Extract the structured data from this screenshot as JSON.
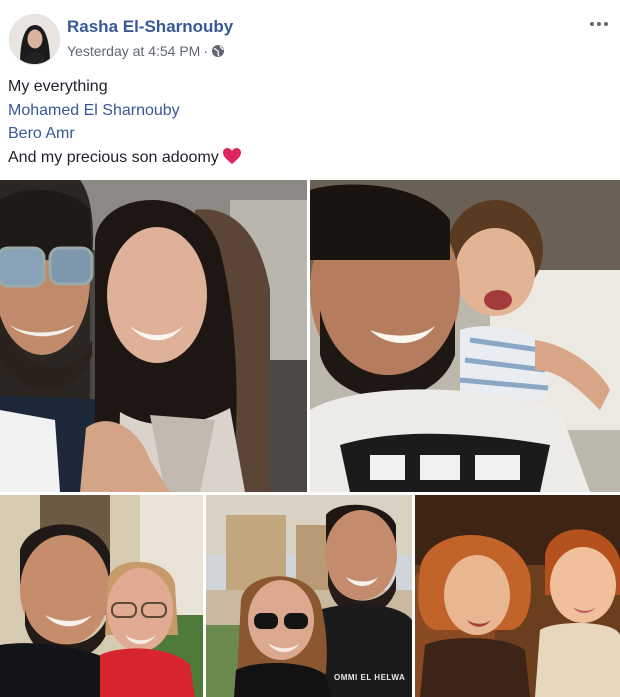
{
  "post": {
    "author_name": "Rasha El-Sharnouby",
    "timestamp": "Yesterday at 4:54 PM",
    "separator": "·",
    "privacy_icon": "globe-icon",
    "more_icon": "more-options-icon",
    "lines": {
      "line1": "My everything",
      "mention1": "Mohamed El Sharnouby",
      "mention2": "Bero Amr",
      "line4": "And my precious son adoomy"
    },
    "emoji": "red-heart-icon"
  },
  "photos": {
    "photo5_shirt_text": "OMMI EL HELWA"
  },
  "colors": {
    "link": "#385898",
    "meta": "#606770",
    "heart": "#e0245e"
  }
}
